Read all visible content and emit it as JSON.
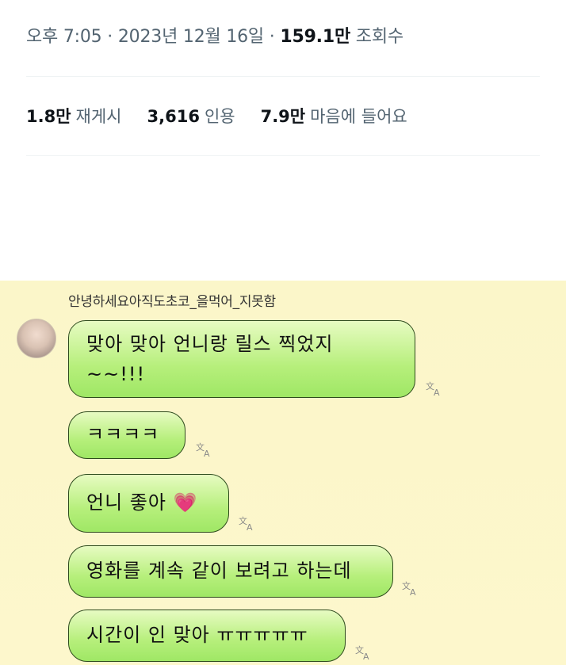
{
  "post_meta": {
    "time": "오후 7:05",
    "sep1": " · ",
    "date": "2023년 12월 16일",
    "sep2": " · ",
    "views": "159.1만",
    "views_label": "조회수"
  },
  "stats": [
    {
      "value": "1.8만",
      "label": "재게시"
    },
    {
      "value": "3,616",
      "label": "인용"
    },
    {
      "value": "7.9만",
      "label": "마음에 들어요"
    }
  ],
  "chat": {
    "sender_name": "안녕하세요아직도초코_을먹어_지못함",
    "messages": [
      {
        "line1": "맞아 맞아 언니랑 릴스 찍었지",
        "line2": "~~!!!"
      },
      {
        "line1": "ㅋㅋㅋㅋ"
      },
      {
        "line1": "언니 좋아 💗"
      },
      {
        "line1": "영화를 계속 같이 보려고 하는데"
      },
      {
        "line1": "시간이 인 맞아 ㅠㅠㅠㅠㅠ"
      }
    ],
    "icons": {
      "translate": "translate-icon",
      "avatar": "avatar"
    },
    "colors": {
      "bubble": "#b6ef7b",
      "background": "#fbf6c9"
    }
  }
}
